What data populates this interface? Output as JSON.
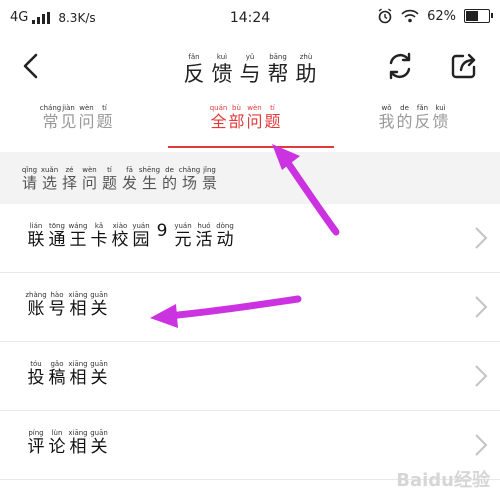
{
  "status_bar": {
    "network": "4G",
    "speed": "8.3K/s",
    "time": "14:24",
    "battery": "62%",
    "battery_level": 0.62,
    "icons": [
      "alarm-icon",
      "wifi-icon",
      "battery-icon",
      "signal-icon"
    ]
  },
  "header": {
    "title": [
      {
        "py": "fǎn",
        "hz": "反"
      },
      {
        "py": "kuì",
        "hz": "馈"
      },
      {
        "py": "yǔ",
        "hz": "与"
      },
      {
        "py": "bāng",
        "hz": "帮"
      },
      {
        "py": "zhù",
        "hz": "助"
      }
    ]
  },
  "tabs": [
    {
      "chars": [
        {
          "py": "cháng",
          "hz": "常"
        },
        {
          "py": "jiàn",
          "hz": "见"
        },
        {
          "py": "wèn",
          "hz": "问"
        },
        {
          "py": "tí",
          "hz": "题"
        }
      ]
    },
    {
      "chars": [
        {
          "py": "quán",
          "hz": "全"
        },
        {
          "py": "bù",
          "hz": "部"
        },
        {
          "py": "wèn",
          "hz": "问"
        },
        {
          "py": "tí",
          "hz": "题"
        }
      ]
    },
    {
      "chars": [
        {
          "py": "wǒ",
          "hz": "我"
        },
        {
          "py": "de",
          "hz": "的"
        },
        {
          "py": "fǎn",
          "hz": "反"
        },
        {
          "py": "kuì",
          "hz": "馈"
        }
      ]
    }
  ],
  "hint": [
    {
      "py": "qǐng",
      "hz": "请"
    },
    {
      "py": "xuǎn",
      "hz": "选"
    },
    {
      "py": "zé",
      "hz": "择"
    },
    {
      "py": "wèn",
      "hz": "问"
    },
    {
      "py": "tí",
      "hz": "题"
    },
    {
      "py": "fā",
      "hz": "发"
    },
    {
      "py": "shēng",
      "hz": "生"
    },
    {
      "py": "de",
      "hz": "的"
    },
    {
      "py": "chǎng",
      "hz": "场"
    },
    {
      "py": "jǐng",
      "hz": "景"
    }
  ],
  "items": [
    {
      "chars": [
        {
          "py": "lián",
          "hz": "联"
        },
        {
          "py": "tōng",
          "hz": "通"
        },
        {
          "py": "wáng",
          "hz": "王"
        },
        {
          "py": "kǎ",
          "hz": "卡"
        },
        {
          "py": "xiào",
          "hz": "校"
        },
        {
          "py": "yuán",
          "hz": "园"
        },
        {
          "py": "",
          "hz": "9"
        },
        {
          "py": "yuán",
          "hz": "元"
        },
        {
          "py": "huó",
          "hz": "活"
        },
        {
          "py": "dòng",
          "hz": "动"
        }
      ]
    },
    {
      "chars": [
        {
          "py": "zhàng",
          "hz": "账"
        },
        {
          "py": "hào",
          "hz": "号"
        },
        {
          "py": "xiāng",
          "hz": "相"
        },
        {
          "py": "guān",
          "hz": "关"
        }
      ]
    },
    {
      "chars": [
        {
          "py": "tóu",
          "hz": "投"
        },
        {
          "py": "gǎo",
          "hz": "稿"
        },
        {
          "py": "xiāng",
          "hz": "相"
        },
        {
          "py": "guān",
          "hz": "关"
        }
      ]
    },
    {
      "chars": [
        {
          "py": "píng",
          "hz": "评"
        },
        {
          "py": "lùn",
          "hz": "论"
        },
        {
          "py": "xiāng",
          "hz": "相"
        },
        {
          "py": "guān",
          "hz": "关"
        }
      ]
    }
  ],
  "colors": {
    "accent": "#e23a3a",
    "arrow": "#cc33e0"
  },
  "watermark": "Baidu经验"
}
